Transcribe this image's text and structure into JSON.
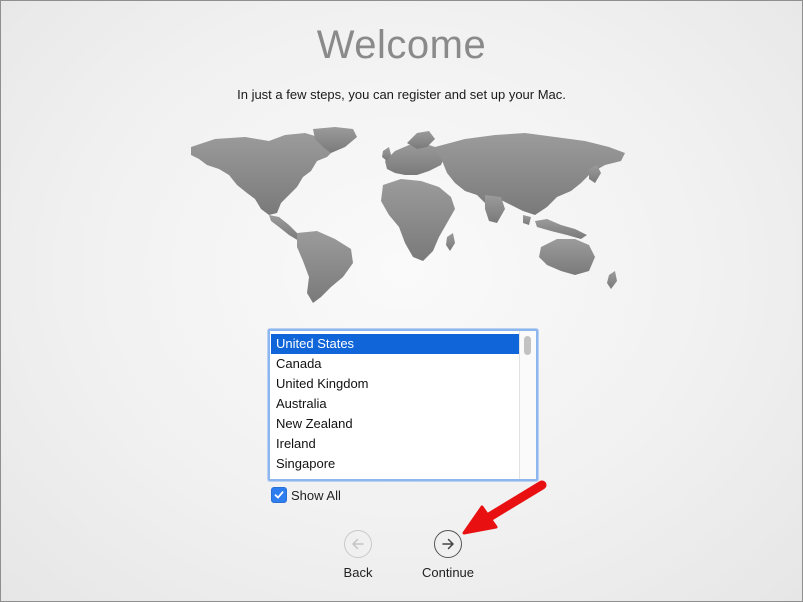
{
  "header": {
    "title": "Welcome",
    "subtitle": "In just a few steps, you can register and set up your Mac."
  },
  "country_list": {
    "items": [
      {
        "label": "United States",
        "selected": true
      },
      {
        "label": "Canada",
        "selected": false
      },
      {
        "label": "United Kingdom",
        "selected": false
      },
      {
        "label": "Australia",
        "selected": false
      },
      {
        "label": "New Zealand",
        "selected": false
      },
      {
        "label": "Ireland",
        "selected": false
      },
      {
        "label": "Singapore",
        "selected": false
      }
    ]
  },
  "show_all": {
    "label": "Show All",
    "checked": true
  },
  "navigation": {
    "back_label": "Back",
    "continue_label": "Continue"
  },
  "colors": {
    "selection": "#1065d8",
    "title": "#8a8a8a",
    "map": "#8c8c8c",
    "annotation_arrow": "#e81010"
  },
  "icons": {
    "back": "arrow-left-circle-icon",
    "continue": "arrow-right-circle-icon",
    "check": "checkmark-icon"
  }
}
